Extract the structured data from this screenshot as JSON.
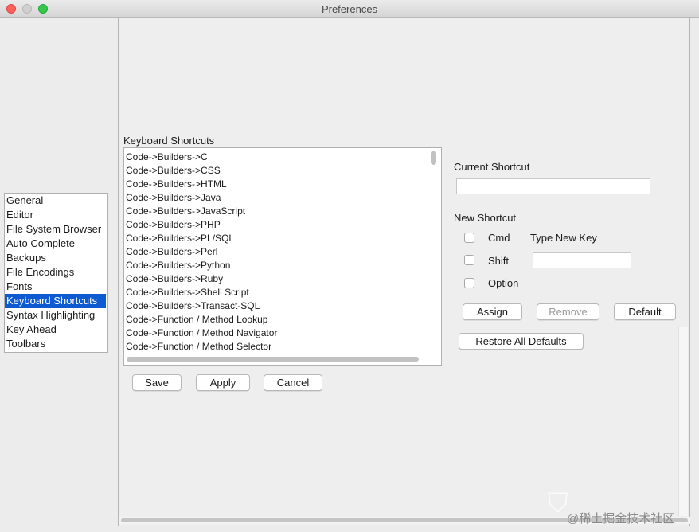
{
  "window": {
    "title": "Preferences"
  },
  "categories": [
    {
      "label": "General"
    },
    {
      "label": "Editor"
    },
    {
      "label": "File System Browser"
    },
    {
      "label": "Auto Complete"
    },
    {
      "label": "Backups"
    },
    {
      "label": "File Encodings"
    },
    {
      "label": "Fonts"
    },
    {
      "label": "Keyboard Shortcuts",
      "selected": true
    },
    {
      "label": "Syntax Highlighting"
    },
    {
      "label": "Key Ahead"
    },
    {
      "label": "Toolbars"
    }
  ],
  "shortcuts": {
    "label": "Keyboard Shortcuts",
    "items": [
      "Code->Builders->C",
      "Code->Builders->CSS",
      "Code->Builders->HTML",
      "Code->Builders->Java",
      "Code->Builders->JavaScript",
      "Code->Builders->PHP",
      "Code->Builders->PL/SQL",
      "Code->Builders->Perl",
      "Code->Builders->Python",
      "Code->Builders->Ruby",
      "Code->Builders->Shell Script",
      "Code->Builders->Transact-SQL",
      "Code->Function / Method Lookup",
      "Code->Function / Method Navigator",
      "Code->Function / Method Selector"
    ]
  },
  "current_shortcut": {
    "label": "Current Shortcut",
    "value": ""
  },
  "new_shortcut": {
    "label": "New Shortcut",
    "cmd_label": "Cmd",
    "shift_label": "Shift",
    "option_label": "Option",
    "type_new_key_label": "Type New Key",
    "key_value": ""
  },
  "buttons": {
    "assign": "Assign",
    "remove": "Remove",
    "default": "Default",
    "restore_all": "Restore All Defaults",
    "save": "Save",
    "apply": "Apply",
    "cancel": "Cancel"
  },
  "watermark": {
    "icon": "shield-logo-icon",
    "text": "@稀土掘金技术社区"
  },
  "colors": {
    "selection": "#0d5ad1",
    "close": "#fc605c",
    "maximize": "#34c84a"
  }
}
